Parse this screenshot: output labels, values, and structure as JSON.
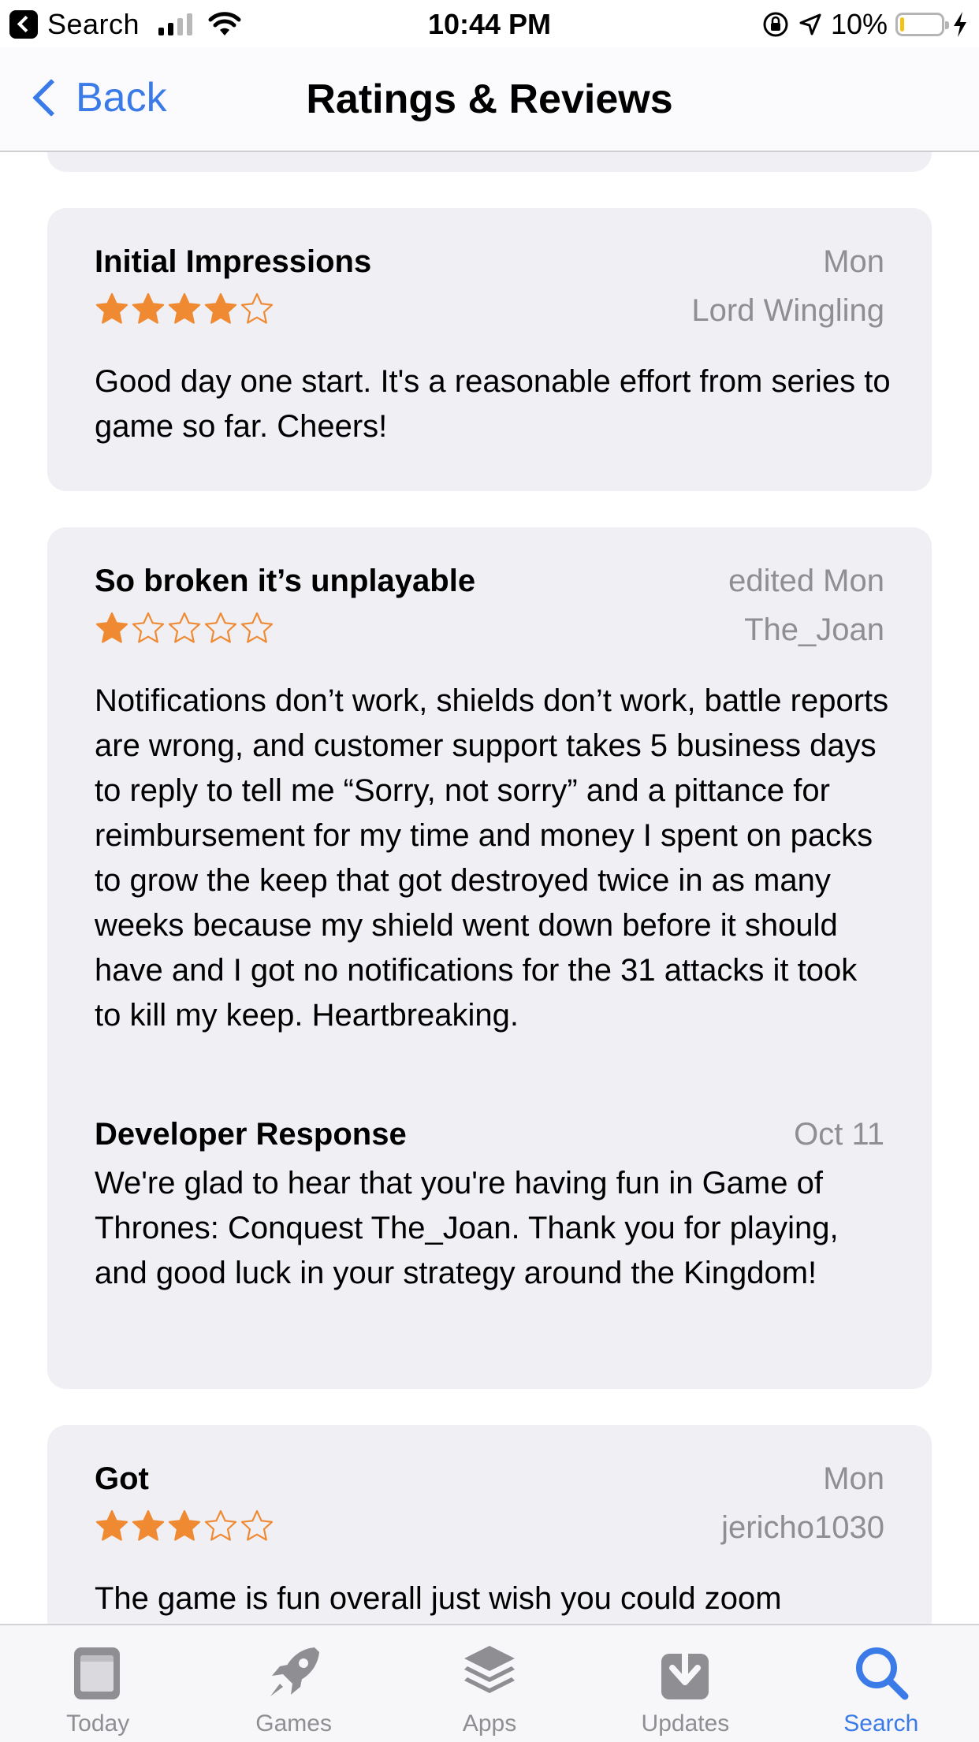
{
  "status_bar": {
    "back_app_label": "Search",
    "time": "10:44 PM",
    "battery_pct": "10%",
    "battery_level": 0.1,
    "signal_bars_filled": 2,
    "signal_bars_total": 4
  },
  "nav": {
    "back_label": "Back",
    "title": "Ratings & Reviews"
  },
  "reviews": [
    {
      "title": "Initial Impressions",
      "date": "Mon",
      "author": "Lord Wingling",
      "rating": 4,
      "body": "Good day one start. It's a reasonable effort from series to game so far. Cheers!"
    },
    {
      "title": "So broken it’s unplayable",
      "date": "edited Mon",
      "author": "The_Joan",
      "rating": 1,
      "body": "Notifications don’t work, shields don’t work, battle reports are wrong, and customer support takes 5 business days to reply to tell me “Sorry, not sorry” and a pittance for reimbursement for my time and money I spent on packs to grow the keep that got destroyed twice in as many weeks because my shield went down before it should have and I got no notifications for the 31 attacks it took to kill my keep. Heartbreaking.",
      "developer_response": {
        "title": "Developer Response",
        "date": "Oct 11",
        "body": "We're glad to hear that you're having fun in Game of Thrones: Conquest The_Joan.  Thank you for playing, and good luck in your strategy around the Kingdom!"
      }
    },
    {
      "title": "Got",
      "date": "Mon",
      "author": "jericho1030",
      "rating": 3,
      "body": "The game is fun overall just wish you could zoom"
    }
  ],
  "tabs": [
    {
      "label": "Today",
      "icon": "today-icon"
    },
    {
      "label": "Games",
      "icon": "rocket-icon"
    },
    {
      "label": "Apps",
      "icon": "layers-icon"
    },
    {
      "label": "Updates",
      "icon": "download-icon"
    },
    {
      "label": "Search",
      "icon": "search-icon",
      "active": true
    }
  ],
  "colors": {
    "accent": "#3b7be8",
    "star": "#ef8a33",
    "card_bg": "#efeff4",
    "secondary_text": "#8e8e93"
  }
}
